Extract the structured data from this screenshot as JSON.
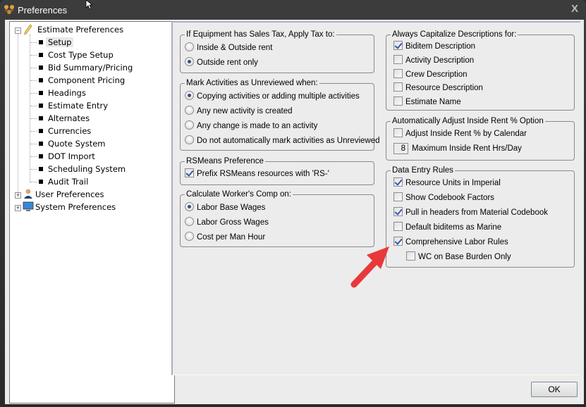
{
  "window": {
    "title": "Preferences",
    "close_label": "X"
  },
  "tree": {
    "root": {
      "label": "Estimate Preferences",
      "expander": "−",
      "children": [
        {
          "label": "Setup",
          "selected": true
        },
        {
          "label": "Cost Type Setup"
        },
        {
          "label": "Bid Summary/Pricing"
        },
        {
          "label": "Component Pricing"
        },
        {
          "label": "Headings"
        },
        {
          "label": "Estimate Entry"
        },
        {
          "label": "Alternates"
        },
        {
          "label": "Currencies"
        },
        {
          "label": "Quote System"
        },
        {
          "label": "DOT Import"
        },
        {
          "label": "Scheduling System"
        },
        {
          "label": "Audit Trail"
        }
      ]
    },
    "others": [
      {
        "label": "User Preferences",
        "expander": "+",
        "icon": "user-icon"
      },
      {
        "label": "System Preferences",
        "expander": "+",
        "icon": "monitor-icon"
      }
    ]
  },
  "groups": {
    "sales_tax": {
      "title": "If Equipment has Sales Tax, Apply Tax to:",
      "options": [
        {
          "label": "Inside & Outside rent",
          "selected": false
        },
        {
          "label": "Outside rent only",
          "selected": true
        }
      ]
    },
    "unreviewed": {
      "title": "Mark Activities as Unreviewed when:",
      "options": [
        {
          "label": "Copying activities or adding multiple activities",
          "selected": true
        },
        {
          "label": "Any new activity is created",
          "selected": false
        },
        {
          "label": "Any change is made to an activity",
          "selected": false
        },
        {
          "label": "Do not automatically mark activities as Unreviewed",
          "selected": false
        }
      ]
    },
    "rsmeans": {
      "title": "RSMeans Preference",
      "options": [
        {
          "label": "Prefix RSMeans resources with 'RS-'",
          "checked": true
        }
      ]
    },
    "workers_comp": {
      "title": "Calculate Worker's Comp on:",
      "options": [
        {
          "label": "Labor Base Wages",
          "selected": true
        },
        {
          "label": "Labor Gross Wages",
          "selected": false
        },
        {
          "label": "Cost per Man Hour",
          "selected": false
        }
      ]
    },
    "capitalize": {
      "title": "Always Capitalize Descriptions for:",
      "options": [
        {
          "label": "Biditem Description",
          "checked": true
        },
        {
          "label": "Activity Description",
          "checked": false
        },
        {
          "label": "Crew Description",
          "checked": false
        },
        {
          "label": "Resource Description",
          "checked": false
        },
        {
          "label": "Estimate Name",
          "checked": false
        }
      ]
    },
    "inside_rent": {
      "title": "Automatically Adjust Inside Rent % Option",
      "adjust_label": "Adjust Inside Rent % by Calendar",
      "adjust_checked": false,
      "max_hours_value": "8",
      "max_hours_label": "Maximum Inside Rent Hrs/Day"
    },
    "data_entry": {
      "title": "Data Entry Rules",
      "options": [
        {
          "label": "Resource Units in Imperial",
          "checked": true
        },
        {
          "label": "Show Codebook Factors",
          "checked": false
        },
        {
          "label": "Pull in headers from Material Codebook",
          "checked": true
        },
        {
          "label": "Default biditems as Marine",
          "checked": false
        },
        {
          "label": "Comprehensive Labor Rules",
          "checked": true
        },
        {
          "label": "WC on Base Burden Only",
          "checked": false
        }
      ]
    }
  },
  "footer": {
    "ok_label": "OK"
  },
  "annotation": {
    "arrow_color": "#e8393a"
  }
}
